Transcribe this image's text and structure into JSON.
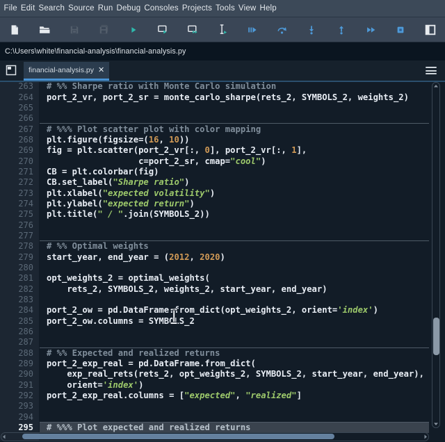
{
  "menu": {
    "items": [
      "File",
      "Edit",
      "Search",
      "Source",
      "Run",
      "Debug",
      "Consoles",
      "Projects",
      "Tools",
      "View",
      "Help"
    ]
  },
  "toolbar": {
    "buttons": [
      {
        "name": "new-file",
        "disabled": false
      },
      {
        "name": "open-file",
        "disabled": false
      },
      {
        "name": "save",
        "disabled": true
      },
      {
        "name": "save-all",
        "disabled": true
      },
      {
        "name": "run",
        "disabled": false
      },
      {
        "name": "run-cell",
        "disabled": false
      },
      {
        "name": "run-cell-advance",
        "disabled": false
      },
      {
        "name": "run-selection",
        "disabled": false
      },
      {
        "name": "debug",
        "disabled": false
      },
      {
        "name": "step-over",
        "disabled": false
      },
      {
        "name": "step-into",
        "disabled": false
      },
      {
        "name": "step-out",
        "disabled": false
      },
      {
        "name": "continue",
        "disabled": false
      },
      {
        "name": "stop",
        "disabled": false
      },
      {
        "name": "maximize-pane",
        "disabled": false
      }
    ]
  },
  "pathbar": {
    "path": "C:\\Users\\white\\financial-analysis\\financial-analysis.py"
  },
  "tabs": {
    "active_label": "financial-analysis.py",
    "close_glyph": "✕"
  },
  "colors": {
    "accent_blue": "#4791d2",
    "run_teal": "#2fb9ac",
    "debug_blue": "#4e9ad8",
    "icon_white": "#e7ebef",
    "icon_gray": "#535e6b",
    "string": "#9dc96b",
    "number": "#d19a56",
    "comment": "#808e9b",
    "code": "#e9eef5"
  },
  "editor": {
    "lines": [
      {
        "n": 263,
        "tokens": [
          [
            "cm",
            "# %% Sharpe ratio with Monte Carlo simulation"
          ]
        ]
      },
      {
        "n": 264,
        "tokens": [
          [
            "t",
            "port_2_vr, port_2_sr = monte_carlo_sharpe(rets_2, SYMBOLS_2, weights_2)"
          ]
        ]
      },
      {
        "n": 265,
        "tokens": []
      },
      {
        "n": 266,
        "tokens": []
      },
      {
        "n": 267,
        "sep": true,
        "tokens": [
          [
            "cm",
            "# %%% Plot scatter plot with color mapping"
          ]
        ]
      },
      {
        "n": 268,
        "tokens": [
          [
            "t",
            "plt.figure(figsize=("
          ],
          [
            "n",
            "16"
          ],
          [
            "t",
            ", "
          ],
          [
            "n",
            "10"
          ],
          [
            "t",
            "))"
          ]
        ]
      },
      {
        "n": 269,
        "tokens": [
          [
            "t",
            "fig = plt.scatter(port_2_vr[:, "
          ],
          [
            "n",
            "0"
          ],
          [
            "t",
            "], port_2_vr[:, "
          ],
          [
            "n",
            "1"
          ],
          [
            "t",
            "],"
          ]
        ]
      },
      {
        "n": 270,
        "tokens": [
          [
            "t",
            "                  c=port_2_sr, cmap="
          ],
          [
            "s",
            "\"cool\""
          ],
          [
            "t",
            ")"
          ]
        ]
      },
      {
        "n": 271,
        "tokens": [
          [
            "t",
            "CB = plt.colorbar(fig)"
          ]
        ]
      },
      {
        "n": 272,
        "tokens": [
          [
            "t",
            "CB.set_label("
          ],
          [
            "s",
            "\"Sharpe ratio\""
          ],
          [
            "t",
            ")"
          ]
        ]
      },
      {
        "n": 273,
        "tokens": [
          [
            "t",
            "plt.xlabel("
          ],
          [
            "s",
            "\"expected volatility\""
          ],
          [
            "t",
            ")"
          ]
        ]
      },
      {
        "n": 274,
        "tokens": [
          [
            "t",
            "plt.ylabel("
          ],
          [
            "s",
            "\"expected return\""
          ],
          [
            "t",
            ")"
          ]
        ]
      },
      {
        "n": 275,
        "tokens": [
          [
            "t",
            "plt.title("
          ],
          [
            "s",
            "\" / \""
          ],
          [
            "t",
            ".join(SYMBOLS_2))"
          ]
        ]
      },
      {
        "n": 276,
        "tokens": []
      },
      {
        "n": 277,
        "tokens": []
      },
      {
        "n": 278,
        "sep": true,
        "tokens": [
          [
            "cm",
            "# %% Optimal weights"
          ]
        ]
      },
      {
        "n": 279,
        "tokens": [
          [
            "t",
            "start_year, end_year = ("
          ],
          [
            "n",
            "2012"
          ],
          [
            "t",
            ", "
          ],
          [
            "n",
            "2020"
          ],
          [
            "t",
            ")"
          ]
        ]
      },
      {
        "n": 280,
        "tokens": []
      },
      {
        "n": 281,
        "tokens": [
          [
            "t",
            "opt_weights_2 = optimal_weights("
          ]
        ]
      },
      {
        "n": 282,
        "tokens": [
          [
            "t",
            "    rets_2, SYMBOLS_2, weights_2, start_year, end_year)"
          ]
        ]
      },
      {
        "n": 283,
        "tokens": []
      },
      {
        "n": 284,
        "tokens": [
          [
            "t",
            "port_2_ow = pd.DataFrame.from_dict(opt_weights_2, orient="
          ],
          [
            "s",
            "'index'"
          ],
          [
            "t",
            ")"
          ]
        ]
      },
      {
        "n": 285,
        "tokens": [
          [
            "t",
            "port_2_ow.columns = SYMBOLS_2"
          ]
        ]
      },
      {
        "n": 286,
        "tokens": []
      },
      {
        "n": 287,
        "tokens": []
      },
      {
        "n": 288,
        "sep": true,
        "tokens": [
          [
            "cm",
            "# %% Expected and realized returns"
          ]
        ]
      },
      {
        "n": 289,
        "tokens": [
          [
            "t",
            "port_2_exp_real = pd.DataFrame.from_dict("
          ]
        ]
      },
      {
        "n": 290,
        "tokens": [
          [
            "t",
            "    exp_real_rets(rets_2, opt_weights_2, SYMBOLS_2, start_year, end_year),"
          ]
        ]
      },
      {
        "n": 291,
        "tokens": [
          [
            "t",
            "    orient="
          ],
          [
            "s",
            "'index'"
          ],
          [
            "t",
            ")"
          ]
        ]
      },
      {
        "n": 292,
        "tokens": [
          [
            "t",
            "port_2_exp_real.columns = ["
          ],
          [
            "s",
            "\"expected\""
          ],
          [
            "t",
            ", "
          ],
          [
            "s",
            "\"realized\""
          ],
          [
            "t",
            "]"
          ]
        ]
      },
      {
        "n": 293,
        "tokens": []
      },
      {
        "n": 294,
        "tokens": []
      },
      {
        "n": 295,
        "sep": true,
        "hl": true,
        "tokens": [
          [
            "cm",
            "# %%% Plot expected and realized returns"
          ]
        ]
      }
    ]
  }
}
